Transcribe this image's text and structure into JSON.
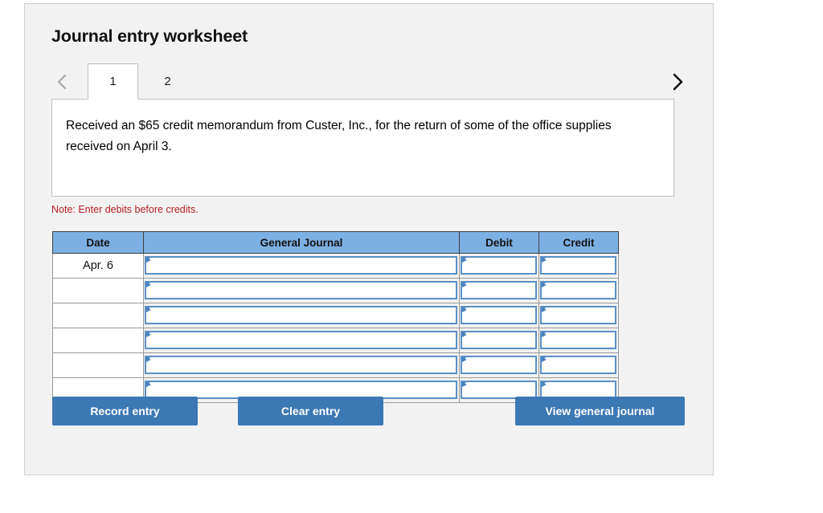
{
  "worksheet": {
    "title": "Journal entry worksheet"
  },
  "tabs": {
    "prev_icon": "chevron-left-icon",
    "next_icon": "chevron-right-icon",
    "items": [
      {
        "label": "1",
        "active": true
      },
      {
        "label": "2",
        "active": false
      }
    ]
  },
  "description": {
    "text": "Received an $65 credit memorandum from Custer, Inc., for the return of some of the office supplies received on April 3."
  },
  "note": {
    "text": "Note: Enter debits before credits."
  },
  "journal_table": {
    "headers": {
      "date": "Date",
      "general_journal": "General Journal",
      "debit": "Debit",
      "credit": "Credit"
    },
    "rows": [
      {
        "date": "Apr.  6",
        "general_journal": "",
        "debit": "",
        "credit": ""
      },
      {
        "date": "",
        "general_journal": "",
        "debit": "",
        "credit": ""
      },
      {
        "date": "",
        "general_journal": "",
        "debit": "",
        "credit": ""
      },
      {
        "date": "",
        "general_journal": "",
        "debit": "",
        "credit": ""
      },
      {
        "date": "",
        "general_journal": "",
        "debit": "",
        "credit": ""
      },
      {
        "date": "",
        "general_journal": "",
        "debit": "",
        "credit": ""
      }
    ]
  },
  "buttons": {
    "record": "Record entry",
    "clear": "Clear entry",
    "view": "View general journal"
  },
  "colors": {
    "button_blue": "#3c78b4",
    "header_blue": "#7cb0e3",
    "input_border_blue": "#5b8fc4",
    "note_red": "#b52025",
    "card_background": "#f2f2f2"
  }
}
